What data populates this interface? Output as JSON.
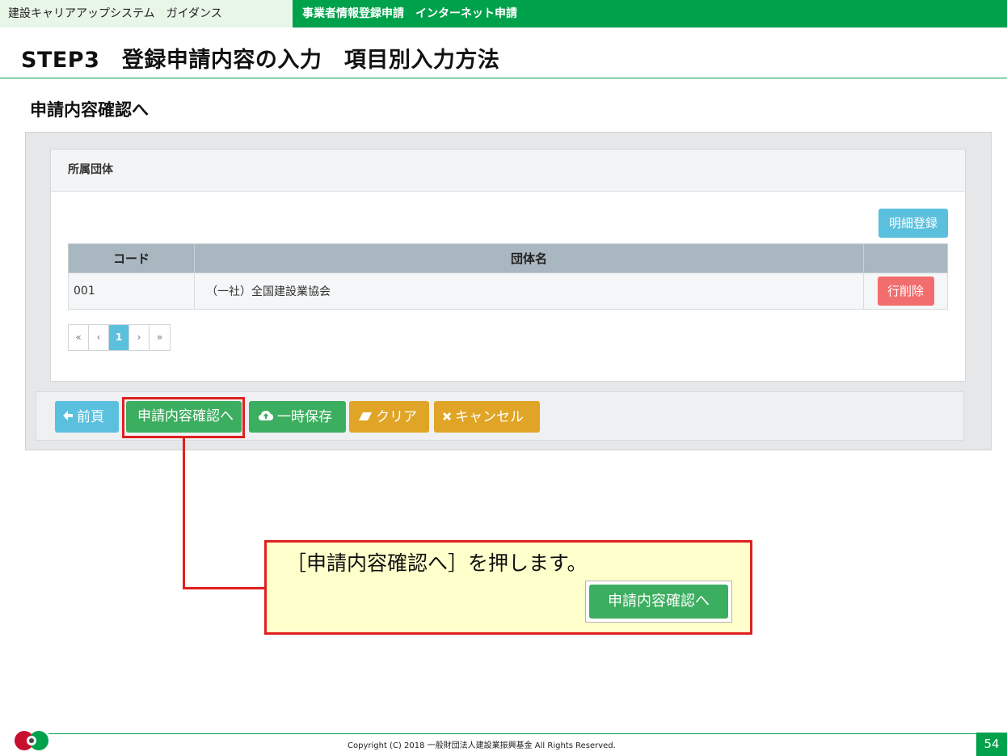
{
  "header": {
    "guide_tab": "建設キャリアアップシステム　ガイダンス",
    "app_tab": "事業者情報登録申請　インターネット申請"
  },
  "step_title": "STEP3　登録申請内容の入力　項目別入力方法",
  "section_title": "申請内容確認へ",
  "card": {
    "title": "所属団体",
    "detail_button": "明細登録",
    "columns": [
      "コード",
      "団体名",
      ""
    ],
    "rows": [
      {
        "code": "001",
        "name": "（一社）全国建設業協会",
        "action": "行削除"
      }
    ]
  },
  "pager": {
    "first": "«",
    "prev": "‹",
    "current": "1",
    "next": "›",
    "last": "»"
  },
  "actions": {
    "prev": "前頁",
    "confirm": "申請内容確認へ",
    "save": "一時保存",
    "clear": "クリア",
    "cancel": "キャンセル"
  },
  "callout": {
    "text": "［申請内容確認へ］を押します。",
    "button": "申請内容確認へ"
  },
  "footer": {
    "copyright": "Copyright (C) 2018 一般財団法人建設業振興基金 All Rights Reserved.",
    "page_number": "54"
  },
  "icons": {
    "prev": "arrow-left-icon",
    "save": "cloud-upload-icon",
    "clear": "eraser-icon",
    "cancel": "close-icon"
  },
  "colors": {
    "brand_green": "#00a14b",
    "info": "#5bc0de",
    "success": "#3cae5f",
    "warning": "#e0a526",
    "danger": "#f26d6d",
    "highlight": "#e02020"
  }
}
